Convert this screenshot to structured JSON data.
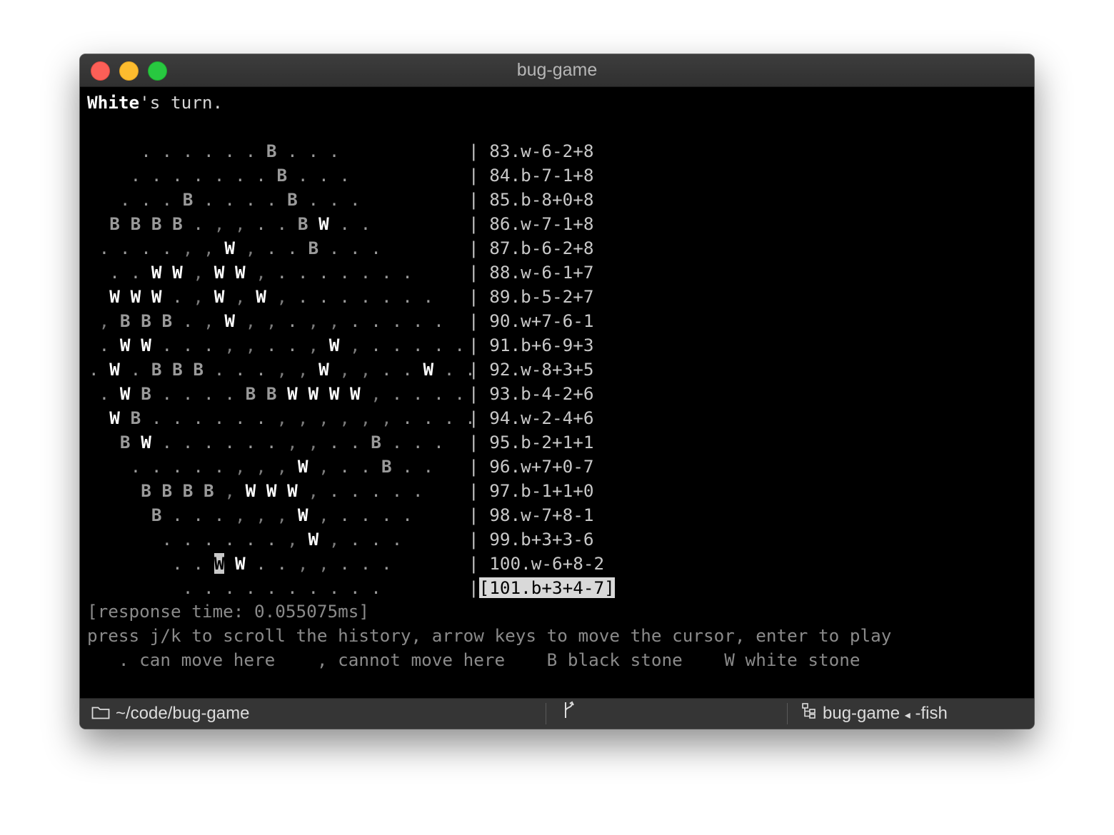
{
  "window": {
    "title": "bug-game"
  },
  "status_line": {
    "player": "White",
    "rest": "'s turn."
  },
  "board": [
    "     . . . . . . B . . .",
    "    . . . . . . . B . . .",
    "   . . . B . . . . B . . .",
    "  B B B B . , , . . B W . .",
    " . . . . , , W , . . B . . .",
    "  . . W W , W W , . . . . . . .",
    "  W W W . , W , W , . . . . . . .",
    " , B B B . , W , , . , , . . . . .",
    " . W W . . . , , . . , W , . . . . .",
    ". W . B B B . . . , , W , , . . W . .",
    " . W B . . . . B B W W W W , . . . .",
    "  W B . . . . . . , , , , , , . . . .",
    "   B W . . . . . . , , . . B . . .",
    "    . . . . . , , , W , . . B . .",
    "     B B B B , W W W , . . . . .",
    "      B . . . , , , W , . . . .",
    "       . . . . . . , W , . . .",
    "        . . W W . . , , . . .",
    "         . . . . . . . . . ."
  ],
  "cursor": {
    "row": 17,
    "col": 12
  },
  "history": [
    "83.w-6-2+8",
    "84.b-7-1+8",
    "85.b-8+0+8",
    "86.w-7-1+8",
    "87.b-6-2+8",
    "88.w-6-1+7",
    "89.b-5-2+7",
    "90.w+7-6-1",
    "91.b+6-9+3",
    "92.w-8+3+5",
    "93.b-4-2+6",
    "94.w-2-4+6",
    "95.b-2+1+1",
    "96.w+7+0-7",
    "97.b-1+1+0",
    "98.w-7+8-1",
    "99.b+3+3-6",
    "100.w-6+8-2",
    "101.b+3+4-7"
  ],
  "history_selected": 18,
  "response_time": "[response time: 0.055075ms]",
  "help_line": "press j/k to scroll the history, arrow keys to move the cursor, enter to play",
  "legend_line": "   . can move here    , cannot move here    B black stone    W white stone",
  "statusbar": {
    "path": "~/code/bug-game",
    "session": "bug-game",
    "arrow": "◂",
    "shell": "-fish"
  },
  "colors": {
    "white_stone": "#ffffff",
    "black_stone": "#9a9a9a",
    "cursor_bg": "#c9c9c9",
    "traffic_red": "#fc5f57",
    "traffic_yellow": "#fdbc2e",
    "traffic_green": "#28c840"
  },
  "icons": [
    "close-icon",
    "folder-icon",
    "git-branch-icon",
    "session-tree-icon"
  ]
}
